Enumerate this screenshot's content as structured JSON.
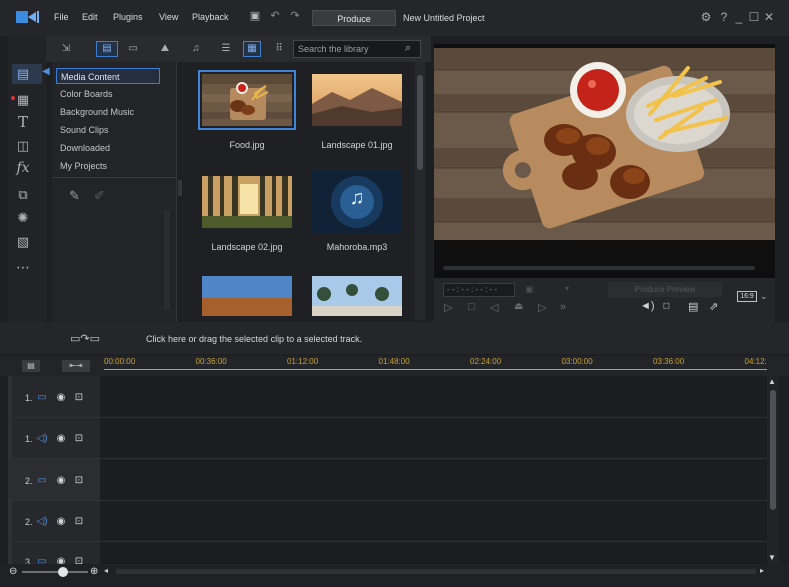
{
  "menu": {
    "items": [
      "File",
      "Edit",
      "Plugins",
      "View",
      "Playback"
    ],
    "produce_label": "Produce",
    "project_name": "New Untitled Project",
    "window_controls": [
      "settings-icon",
      "help-icon",
      "minimize-icon",
      "maximize-icon",
      "close-icon"
    ]
  },
  "library": {
    "search_placeholder": "Search the library",
    "categories": [
      "Media Content",
      "Color Boards",
      "Background Music",
      "Sound Clips",
      "Downloaded",
      "My Projects"
    ],
    "selected_category": "Media Content",
    "media": [
      {
        "label": "Food.jpg",
        "selected": true
      },
      {
        "label": "Landscape 01.jpg"
      },
      {
        "label": "Landscape 02.jpg"
      },
      {
        "label": "Mahoroba.mp3"
      },
      {
        "label": ""
      },
      {
        "label": ""
      }
    ]
  },
  "preview": {
    "timecode": "- - : - - : - - : - -",
    "aspect_ratio": "16:9",
    "produce_preview_label": "Produce Preview"
  },
  "timeline": {
    "instruction": "Click here or drag the selected clip to a selected track.",
    "ruler": [
      "00:00:00",
      "00:36:00",
      "01:12:00",
      "01:48:00",
      "02:24:00",
      "03:00:00",
      "03:36:00",
      "04:12:"
    ],
    "tracks": [
      {
        "label": "1.",
        "type": "video"
      },
      {
        "label": "1.",
        "type": "audio"
      },
      {
        "label": "2.",
        "type": "video"
      },
      {
        "label": "2.",
        "type": "audio"
      },
      {
        "label": "3.",
        "type": "video"
      }
    ]
  },
  "colors": {
    "accent": "#3f86db",
    "timecode": "#c7a23a",
    "background": "#1e1f22"
  }
}
